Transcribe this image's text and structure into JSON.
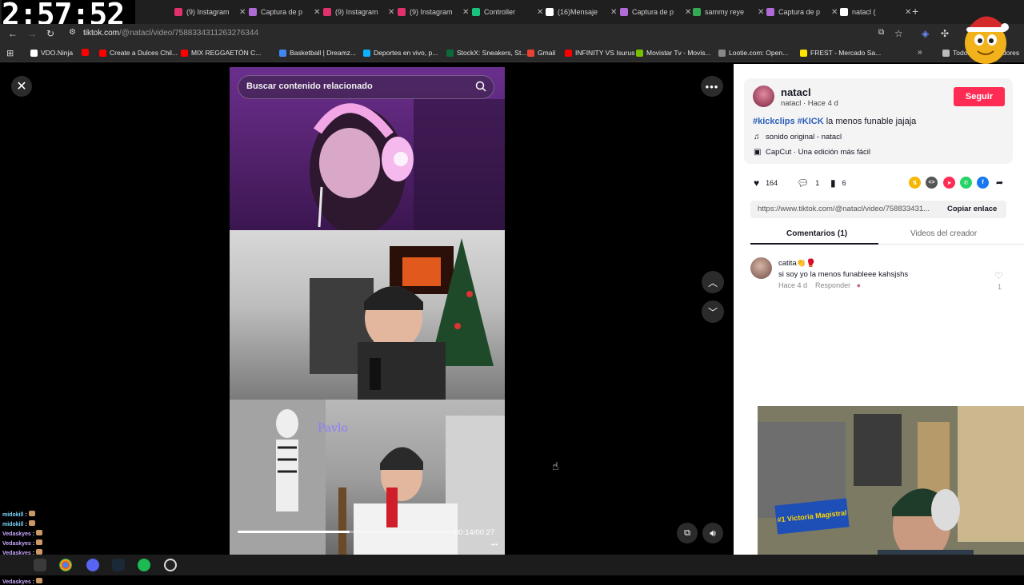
{
  "clock": "2:57:52",
  "tabs": [
    {
      "label": "(9) Instagram",
      "color": "#e1306c"
    },
    {
      "label": "Captura de p",
      "color": "#b26bd6"
    },
    {
      "label": "(9) Instagram",
      "color": "#e1306c"
    },
    {
      "label": "(9) Instagram",
      "color": "#e1306c"
    },
    {
      "label": "Controller",
      "color": "#19c37d"
    },
    {
      "label": "(16)Mensaje",
      "color": "#ffffff"
    },
    {
      "label": "Captura de p",
      "color": "#b26bd6"
    },
    {
      "label": "sammy reye",
      "color": "#34a853"
    },
    {
      "label": "Captura de p",
      "color": "#b26bd6"
    },
    {
      "label": "natacl (",
      "color": "#ffffff"
    }
  ],
  "address": {
    "domain": "tiktok.com",
    "path": "/@natacl/video/7588334311263276344"
  },
  "bookmarks": [
    {
      "label": "VDO.Ninja",
      "color": "#ffffff"
    },
    {
      "label": "",
      "color": "#ff0000"
    },
    {
      "label": "Create a Dulces Chil...",
      "color": "#ff0000"
    },
    {
      "label": "MIX REGGAETÓN C...",
      "color": "#ff0000"
    },
    {
      "label": "Basketball | Dreamz...",
      "color": "#4285f4"
    },
    {
      "label": "Deportes en vivo, p...",
      "color": "#0db1ff"
    },
    {
      "label": "StockX: Sneakers, St...",
      "color": "#0a6a3a"
    },
    {
      "label": "Gmail",
      "color": "#ea4335"
    },
    {
      "label": "INFINITY VS Isurus",
      "color": "#ff0000"
    },
    {
      "label": "Movistar Tv - Movis...",
      "color": "#79c000"
    },
    {
      "label": "Lootie.com: Open...",
      "color": "#888888"
    },
    {
      "label": "FREST - Mercado Sa...",
      "color": "#ffe600"
    },
    {
      "label": "Todos los marcadores",
      "color": "#bbbbbb"
    }
  ],
  "player": {
    "search_placeholder": "Buscar contenido relacionado",
    "time": "00:14/00:27",
    "progress": 0.52
  },
  "creator": {
    "username": "natacl",
    "subline": "natacl · Hace 4 d",
    "follow": "Seguir",
    "caption_tags": [
      "#kickclips",
      "#KICK"
    ],
    "caption_text": "la menos funable jajaja",
    "sound": "sonido original - natacl",
    "capcut": "CapCut · Una edición más fácil"
  },
  "stats": {
    "likes": "164",
    "comments": "1",
    "saves": "6"
  },
  "link": {
    "url": "https://www.tiktok.com/@natacl/video/758833431...",
    "copy": "Copiar enlace"
  },
  "tabs_panel": {
    "comments": "Comentarios (1)",
    "videos": "Videos del creador"
  },
  "comment": {
    "name": "catita👏🥊",
    "text": "si soy yo la menos funableee kahsjshs",
    "time": "Hace 4 d",
    "reply": "Responder",
    "likes": "1"
  },
  "chat": [
    {
      "name": "midokill",
      "sep": " : "
    },
    {
      "name": "midokill",
      "sep": " : "
    },
    {
      "name": "Vedaskyes",
      "sep": " : "
    },
    {
      "name": "Vedaskyes",
      "sep": " : "
    },
    {
      "name": "Vedaskyes",
      "sep": " : "
    },
    {
      "name": "Vedaskyes",
      "sep": " : "
    },
    {
      "name": "Vedaskyes",
      "sep": " : "
    },
    {
      "name": "Vedaskyes",
      "sep": " : "
    }
  ],
  "cam": {
    "banner": "#1 Victoria Magistral"
  }
}
